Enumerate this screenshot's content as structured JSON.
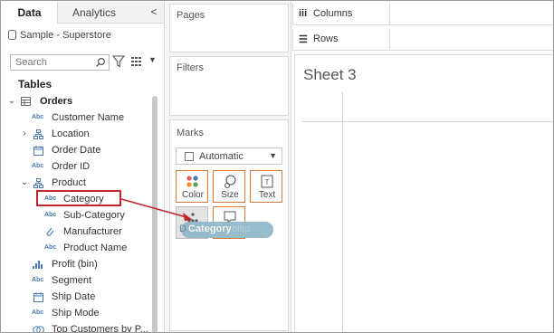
{
  "data_pane": {
    "tabs": [
      {
        "label": "Data",
        "active": true
      },
      {
        "label": "Analytics",
        "active": false
      }
    ],
    "collapse_glyph": "<",
    "data_source": "Sample - Superstore",
    "search_placeholder": "Search",
    "tables_heading": "Tables",
    "tree": [
      {
        "label": "Orders",
        "icon": "table-icon",
        "expander": "expanded"
      },
      {
        "label": "Customer Name",
        "icon": "abc-dimension-icon"
      },
      {
        "label": "Location",
        "icon": "hierarchy-icon",
        "expander": "collapsed"
      },
      {
        "label": "Order Date",
        "icon": "calendar-icon"
      },
      {
        "label": "Order ID",
        "icon": "abc-dimension-icon"
      },
      {
        "label": "Product",
        "icon": "hierarchy-icon",
        "expander": "expanded"
      },
      {
        "label": "Category",
        "icon": "abc-dimension-icon",
        "selected": true
      },
      {
        "label": "Sub-Category",
        "icon": "abc-dimension-icon"
      },
      {
        "label": "Manufacturer",
        "icon": "paperclip-icon"
      },
      {
        "label": "Product Name",
        "icon": "abc-dimension-icon"
      },
      {
        "label": "Profit (bin)",
        "icon": "bin-histogram-icon"
      },
      {
        "label": "Segment",
        "icon": "abc-dimension-icon"
      },
      {
        "label": "Ship Date",
        "icon": "calendar-icon"
      },
      {
        "label": "Ship Mode",
        "icon": "abc-dimension-icon"
      },
      {
        "label": "Top Customers by P...",
        "icon": "set-icon"
      }
    ],
    "abc_glyph": "Abc"
  },
  "shelves": {
    "pages": "Pages",
    "filters": "Filters",
    "marks": "Marks",
    "mark_type": "Automatic",
    "mark_buttons": {
      "color": "Color",
      "size": "Size",
      "text": "Text",
      "detail": "Detail",
      "tooltip": "Tooltip"
    }
  },
  "drag": {
    "field": "Category",
    "ghost_text": "oltip",
    "prefix": "D"
  },
  "view": {
    "columns_label": "Columns",
    "rows_label": "Rows",
    "sheet_title": "Sheet 3"
  },
  "colors": {
    "highlight_red": "#c0272d",
    "marks_orange": "#d07a3e",
    "pill_blue": "#8fb8c9",
    "field_blue": "#4a7ab0"
  }
}
